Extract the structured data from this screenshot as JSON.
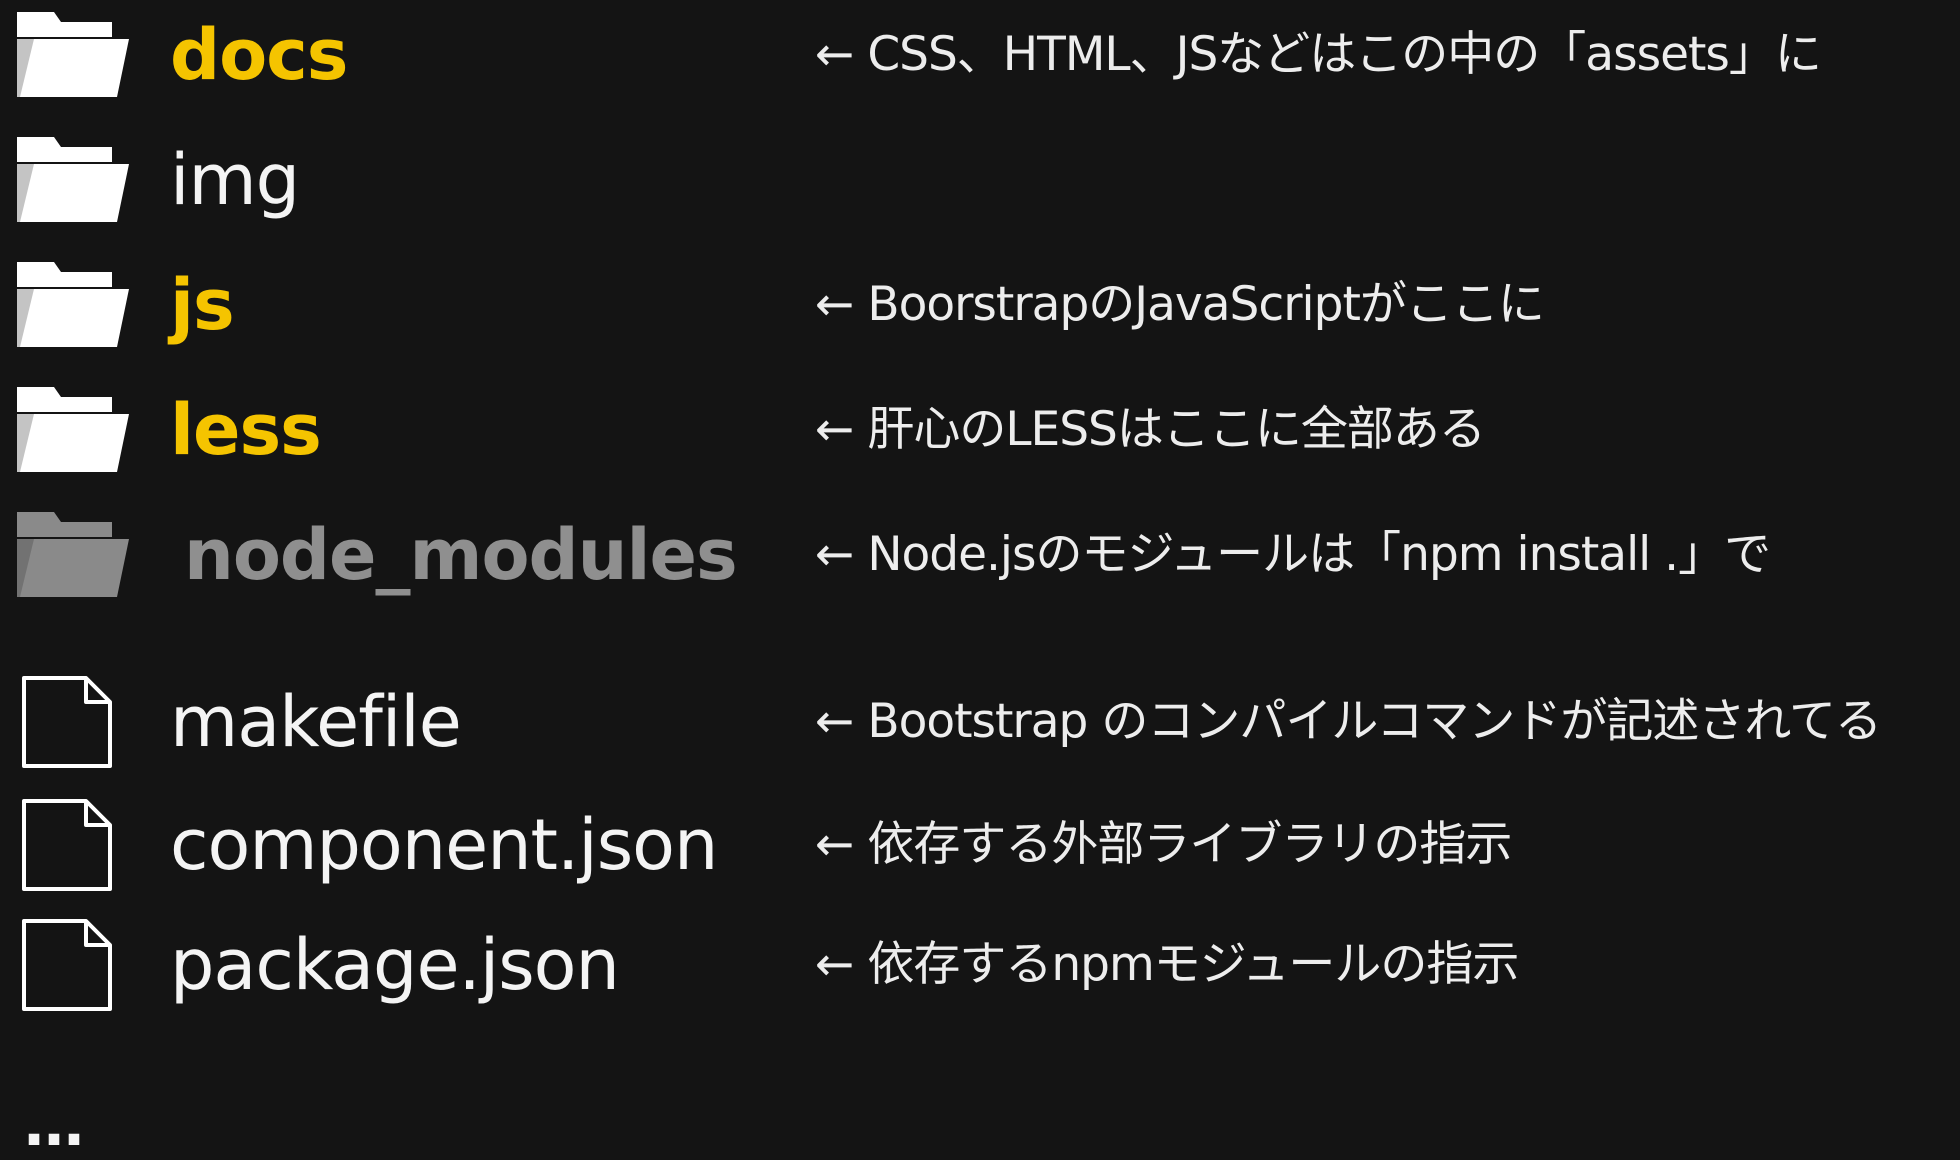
{
  "entries": [
    {
      "name": "docs",
      "description": "← CSS、HTML、JSなどはこの中の「assets」に"
    },
    {
      "name": "img",
      "description": ""
    },
    {
      "name": "js",
      "description": "← BoorstrapのJavaScriptがここに"
    },
    {
      "name": "less",
      "description": "← 肝心のLESSはここに全部ある"
    },
    {
      "name": "node_modules",
      "description": "← Node.jsのモジュールは「npm install .」で"
    },
    {
      "name": "makefile",
      "description": "← Bootstrap のコンパイルコマンドが記述されてる"
    },
    {
      "name": "component.json",
      "description": "← 依存する外部ライブラリの指示"
    },
    {
      "name": "package.json",
      "description": "← 依存するnpmモジュールの指示"
    }
  ],
  "ellipsis": "…",
  "colors": {
    "background": "#141414",
    "highlight": "#f5c400",
    "normal": "#f4f4f4",
    "muted": "#8f8f8f"
  },
  "icons": {
    "folder": "folder-icon",
    "file": "file-icon"
  }
}
